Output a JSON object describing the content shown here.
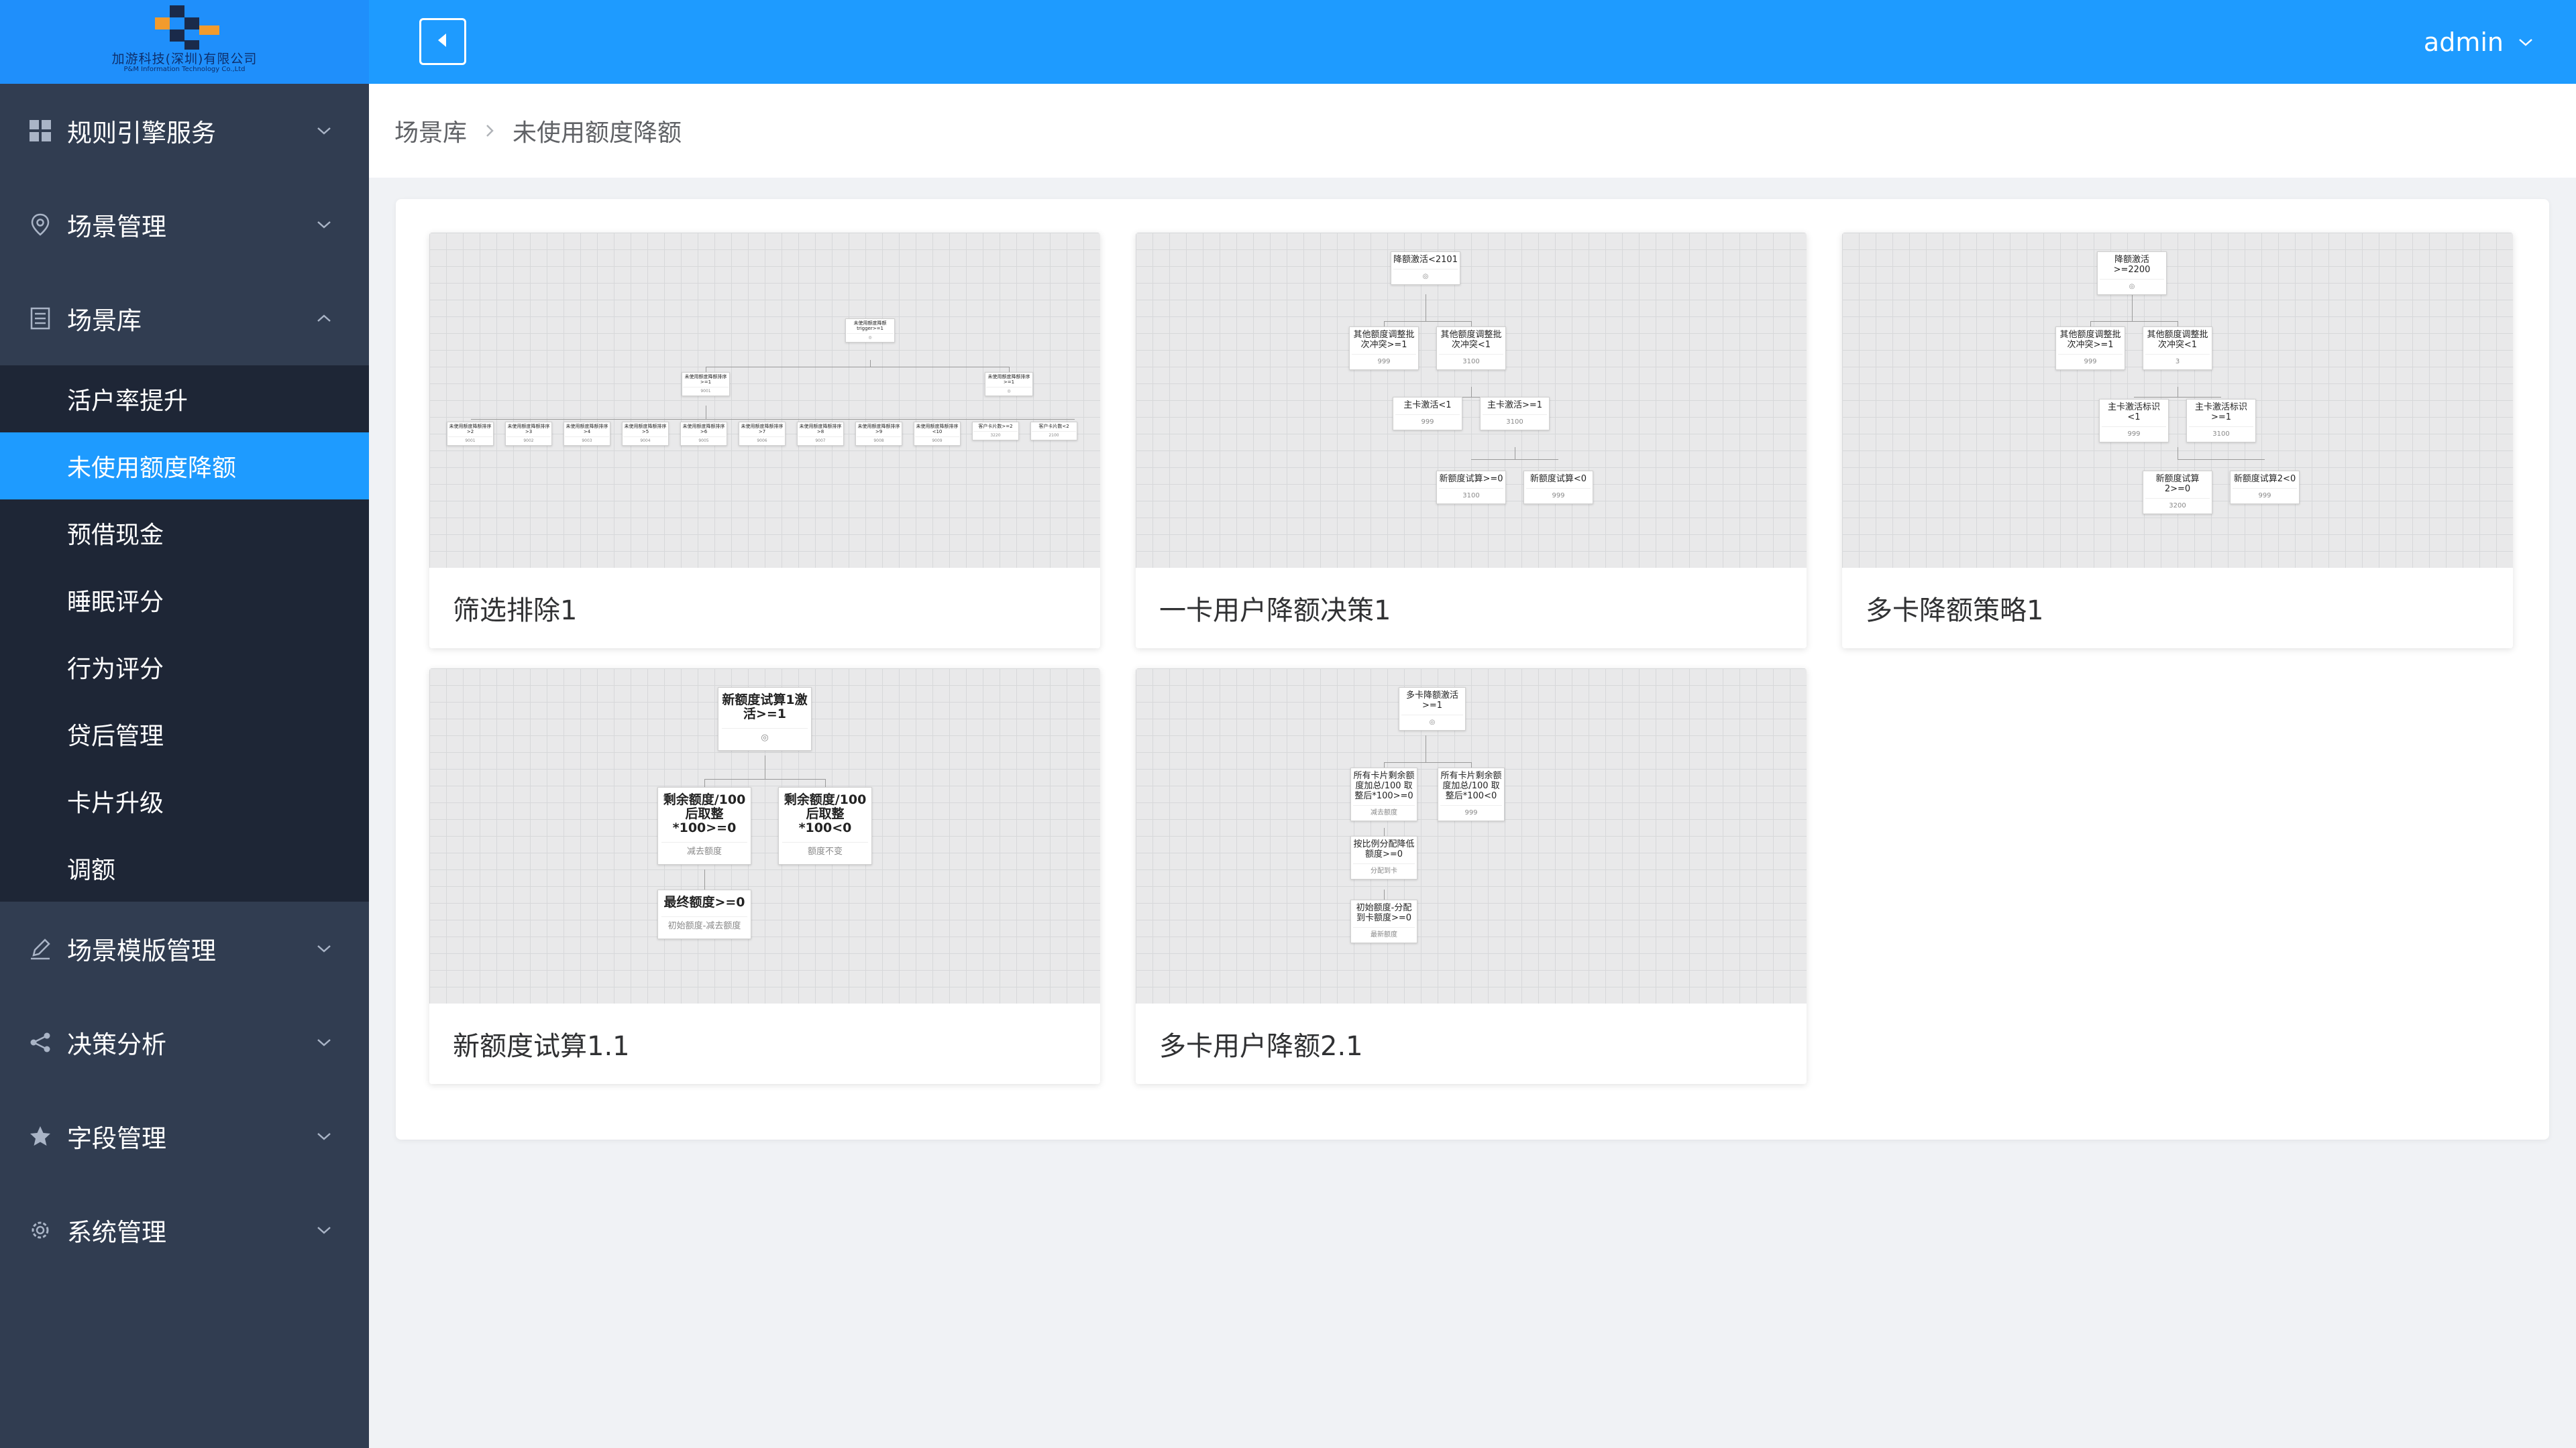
{
  "logo": {
    "company_cn": "加游科技(深圳)有限公司",
    "company_en": "P&M Information Technology Co.,Ltd",
    "colors": {
      "orange": "#f29b2d",
      "dark": "#1a2a4a",
      "accent": "#1f8ffb"
    }
  },
  "sidebar": {
    "menus": [
      {
        "label": "规则引擎服务",
        "icon": "grid-icon",
        "expanded": false
      },
      {
        "label": "场景管理",
        "icon": "location-pin-icon",
        "expanded": false
      },
      {
        "label": "场景库",
        "icon": "document-list-icon",
        "expanded": true,
        "items": [
          {
            "label": "活户率提升",
            "active": false
          },
          {
            "label": "未使用额度降额",
            "active": true
          },
          {
            "label": "预借现金",
            "active": false
          },
          {
            "label": "睡眠评分",
            "active": false
          },
          {
            "label": "行为评分",
            "active": false
          },
          {
            "label": "贷后管理",
            "active": false
          },
          {
            "label": "卡片升级",
            "active": false
          },
          {
            "label": "调额",
            "active": false
          }
        ]
      },
      {
        "label": "场景模版管理",
        "icon": "pencil-icon",
        "expanded": false
      },
      {
        "label": "决策分析",
        "icon": "share-icon",
        "expanded": false
      },
      {
        "label": "字段管理",
        "icon": "star-icon",
        "expanded": false
      },
      {
        "label": "系统管理",
        "icon": "gear-icon",
        "expanded": false
      }
    ]
  },
  "header": {
    "user": "admin",
    "collapse_icon": "caret-left-icon"
  },
  "breadcrumb": {
    "items": [
      "场景库",
      "未使用额度降额"
    ]
  },
  "cards": [
    {
      "title": "筛选排除1",
      "nodes": [
        "未使用额度降额 trigger>=1",
        "未使用额度降额排序>=1",
        "未使用额度降额排序>=1"
      ],
      "leaves": [
        "未使用额度降额排序>2",
        "未使用额度降额排序>3",
        "未使用额度降额排序>4",
        "未使用额度降额排序>5",
        "未使用额度降额排序>6",
        "未使用额度降额排序>7",
        "未使用额度降额排序>8",
        "未使用额度降额排序>9",
        "未使用额度降额排序<10",
        "客户卡片数>=2",
        "客户卡片数<2"
      ],
      "leaf_values": [
        "9001",
        "9002",
        "9003",
        "9004",
        "9005",
        "9006",
        "9007",
        "9008",
        "9009",
        "3220",
        "2100"
      ]
    },
    {
      "title": "一卡用户降额决策1",
      "nodes": [
        {
          "text": "降额激活<2101",
          "value": ""
        },
        {
          "text": "其他额度调整批次冲突>=1",
          "value": "999"
        },
        {
          "text": "其他额度调整批次冲突<1",
          "value": "3100"
        },
        {
          "text": "主卡激活<1",
          "value": "999"
        },
        {
          "text": "主卡激活>=1",
          "value": "3100"
        },
        {
          "text": "新额度试算>=0",
          "value": "3100"
        },
        {
          "text": "新额度试算<0",
          "value": "999"
        }
      ]
    },
    {
      "title": "多卡降额策略1",
      "nodes": [
        {
          "text": "降额激活>=2200",
          "value": ""
        },
        {
          "text": "其他额度调整批次冲突>=1",
          "value": "999"
        },
        {
          "text": "其他额度调整批次冲突<1",
          "value": "3"
        },
        {
          "text": "主卡激活标识<1",
          "value": "999"
        },
        {
          "text": "主卡激活标识>=1",
          "value": "3100"
        },
        {
          "text": "新额度试算2>=0",
          "value": "3200"
        },
        {
          "text": "新额度试算2<0",
          "value": "999"
        }
      ]
    },
    {
      "title": "新额度试算1.1",
      "nodes": [
        {
          "text": "新额度试算1激活>=1",
          "value": ""
        },
        {
          "text": "剩余额度/100 后取整*100>=0",
          "value": "减去额度"
        },
        {
          "text": "剩余额度/100 后取整*100<0",
          "value": "额度不变"
        },
        {
          "text": "最终额度>=0",
          "value": "初始额度-减去额度"
        }
      ]
    },
    {
      "title": "多卡用户降额2.1",
      "nodes": [
        {
          "text": "多卡降额激活>=1",
          "value": ""
        },
        {
          "text": "所有卡片剩余额度加总/100 取整后*100>=0",
          "value": "减去额度"
        },
        {
          "text": "所有卡片剩余额度加总/100 取整后*100<0",
          "value": "999"
        },
        {
          "text": "按比例分配降低额度>=0",
          "value": "分配到卡"
        },
        {
          "text": "初始额度-分配到卡额度>=0",
          "value": "最新额度"
        }
      ]
    }
  ]
}
